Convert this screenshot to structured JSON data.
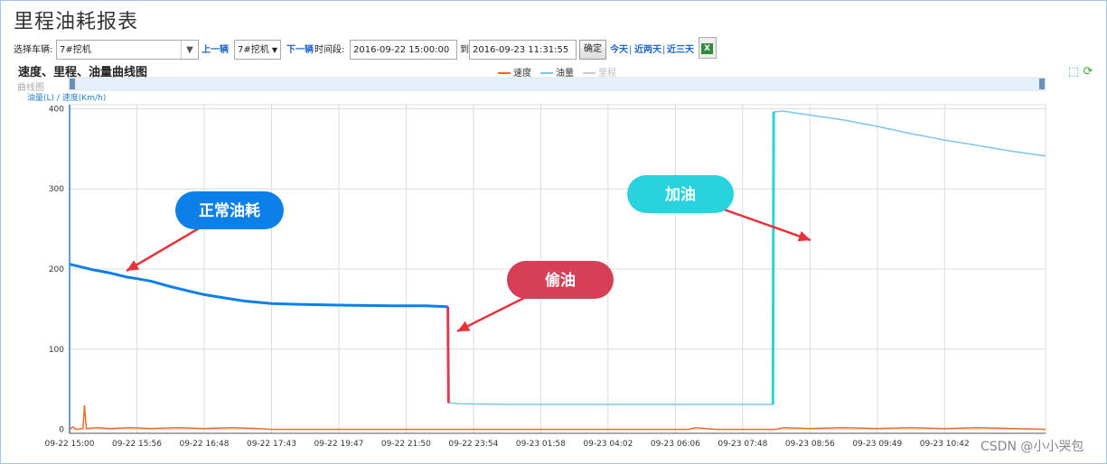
{
  "page": {
    "title": "里程油耗报表"
  },
  "toolbar": {
    "vehicle_label": "选择车辆:",
    "vehicle_value": "7#挖机",
    "prev_label": "上一辆",
    "vehicle_short_value": "7#挖机",
    "next_label": "下一辆",
    "period_label": "时间段:",
    "start_time": "2016-09-22 15:00:00",
    "to_label": "到",
    "end_time": "2016-09-23 11:31:55",
    "confirm_label": "确定",
    "quick_links": [
      "今天",
      "近两天",
      "近三天"
    ],
    "separator": "|"
  },
  "chart_header": {
    "subtitle": "速度、里程、油量曲线图",
    "curve_label": "曲线图",
    "axis_title": "油量(L) / 速度(Km/h)",
    "legend": [
      {
        "name": "速度",
        "color": "#f26b2e",
        "active": true
      },
      {
        "name": "油量",
        "color": "#7ec5ec",
        "active": true
      },
      {
        "name": "里程",
        "color": "#cccccc",
        "active": false
      }
    ]
  },
  "annotations": [
    {
      "text": "正常油耗",
      "color": "#0d7fe8"
    },
    {
      "text": "偷油",
      "color": "#d63f55"
    },
    {
      "text": "加油",
      "color": "#28d3dd"
    }
  ],
  "watermark": "CSDN @小小哭包",
  "chart_data": {
    "type": "line",
    "ylim": [
      -5,
      405
    ],
    "yticks": [
      0,
      100,
      200,
      300,
      400
    ],
    "x_categories": [
      "09-22 15:00",
      "09-22 15:56",
      "09-22 16:48",
      "09-22 17:43",
      "09-22 19:47",
      "09-22 21:50",
      "09-22 23:54",
      "09-23 01:58",
      "09-23 04:02",
      "09-23 06:06",
      "09-23 07:48",
      "09-23 08:56",
      "09-23 09:49",
      "09-23 10:42"
    ],
    "series": [
      {
        "name": "油量",
        "color": "#7ec5ec",
        "points": [
          [
            0,
            206
          ],
          [
            0.15,
            203
          ],
          [
            0.35,
            199
          ],
          [
            0.6,
            195
          ],
          [
            0.85,
            190
          ],
          [
            1.0,
            188
          ],
          [
            1.2,
            185
          ],
          [
            1.5,
            178
          ],
          [
            1.8,
            172
          ],
          [
            2.0,
            168
          ],
          [
            2.3,
            164
          ],
          [
            2.6,
            160
          ],
          [
            3.0,
            157
          ],
          [
            3.4,
            156
          ],
          [
            4.0,
            155
          ],
          [
            4.8,
            154
          ],
          [
            5.3,
            154
          ],
          [
            5.6,
            153
          ],
          [
            5.62,
            153
          ],
          [
            5.63,
            33
          ],
          [
            5.8,
            32
          ],
          [
            6.5,
            31
          ],
          [
            7.5,
            31
          ],
          [
            8.5,
            31
          ],
          [
            9.5,
            31
          ],
          [
            10.45,
            31
          ],
          [
            10.46,
            396
          ],
          [
            10.6,
            397
          ],
          [
            11.0,
            392
          ],
          [
            11.5,
            386
          ],
          [
            12.0,
            378
          ],
          [
            12.5,
            369
          ],
          [
            13.0,
            361
          ],
          [
            13.5,
            354
          ],
          [
            14.0,
            347
          ],
          [
            14.5,
            341
          ]
        ]
      },
      {
        "name": "速度",
        "color": "#f26b2e",
        "points": [
          [
            0,
            0
          ],
          [
            0.05,
            3
          ],
          [
            0.1,
            0
          ],
          [
            0.2,
            1
          ],
          [
            0.22,
            30
          ],
          [
            0.25,
            1
          ],
          [
            0.4,
            2
          ],
          [
            0.6,
            1
          ],
          [
            0.9,
            2
          ],
          [
            1.2,
            1
          ],
          [
            1.6,
            2
          ],
          [
            2.0,
            1
          ],
          [
            2.4,
            2
          ],
          [
            2.8,
            1
          ],
          [
            3.0,
            0
          ],
          [
            9.2,
            0
          ],
          [
            9.3,
            2
          ],
          [
            9.6,
            0
          ],
          [
            10.5,
            0
          ],
          [
            10.6,
            2
          ],
          [
            11.0,
            1
          ],
          [
            11.5,
            2
          ],
          [
            12.0,
            1
          ],
          [
            12.5,
            2
          ],
          [
            13.0,
            1
          ],
          [
            13.5,
            2
          ],
          [
            14.0,
            1
          ],
          [
            14.5,
            0
          ]
        ]
      },
      {
        "name": "里程",
        "color": "#cccccc",
        "points": []
      }
    ]
  }
}
